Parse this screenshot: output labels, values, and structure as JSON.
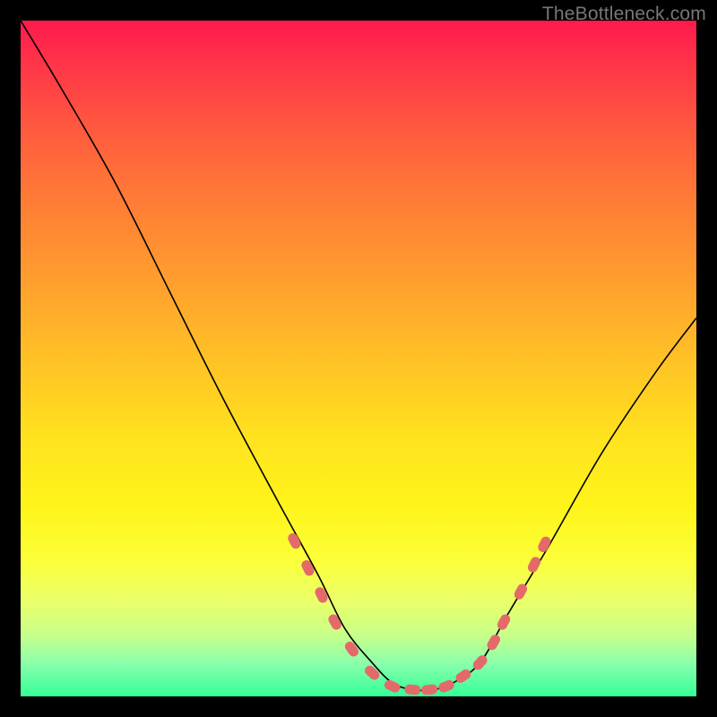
{
  "watermark": "TheBottleneck.com",
  "colors": {
    "dot": "#e46a6a",
    "curve": "#000000",
    "gradient_top": "#ff1a4d",
    "gradient_bottom": "#33ff99",
    "page_bg": "#000000"
  },
  "chart_data": {
    "type": "line",
    "title": "",
    "xlabel": "",
    "ylabel": "",
    "xlim": [
      0,
      100
    ],
    "ylim": [
      0,
      100
    ],
    "series": [
      {
        "name": "bottleneck-curve",
        "x": [
          0,
          6,
          14,
          22,
          30,
          38,
          44,
          48,
          52,
          55,
          58,
          61,
          64,
          68,
          72,
          78,
          86,
          94,
          100
        ],
        "y": [
          100,
          90,
          76,
          60,
          44,
          29,
          18,
          10,
          5,
          2,
          1,
          1,
          2,
          5,
          12,
          22,
          36,
          48,
          56
        ]
      }
    ],
    "markers": {
      "name": "highlight-dots",
      "x": [
        40.5,
        42.5,
        44.5,
        46.5,
        49,
        52,
        55,
        58,
        60.5,
        63,
        65.5,
        68,
        70,
        71.5,
        74,
        76,
        77.5
      ],
      "y": [
        23,
        19,
        15,
        11,
        7,
        3.5,
        1.5,
        1,
        1,
        1.5,
        3,
        5,
        8,
        11,
        15.5,
        19.5,
        22.5
      ]
    }
  }
}
